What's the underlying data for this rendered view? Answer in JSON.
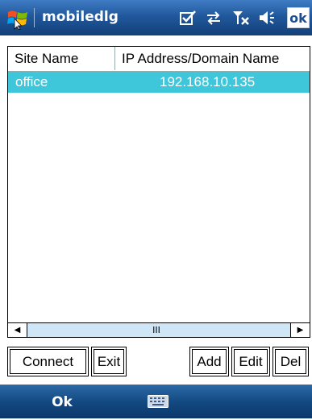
{
  "titlebar": {
    "title": "mobiledlg",
    "ok_label": "ok"
  },
  "list": {
    "columns": [
      "Site Name",
      "IP Address/Domain Name"
    ],
    "rows": [
      {
        "site": "office",
        "address": "192.168.10.135",
        "selected": true
      }
    ],
    "scroll_thumb": "III"
  },
  "buttons": {
    "connect": "Connect",
    "exit": "Exit",
    "add": "Add",
    "edit": "Edit",
    "del": "Del"
  },
  "menubar": {
    "left_softkey": "Ok"
  },
  "colors": {
    "selection": "#3ec7da",
    "title_bar": "#21589c",
    "scroll_track": "#cfe6f6"
  }
}
